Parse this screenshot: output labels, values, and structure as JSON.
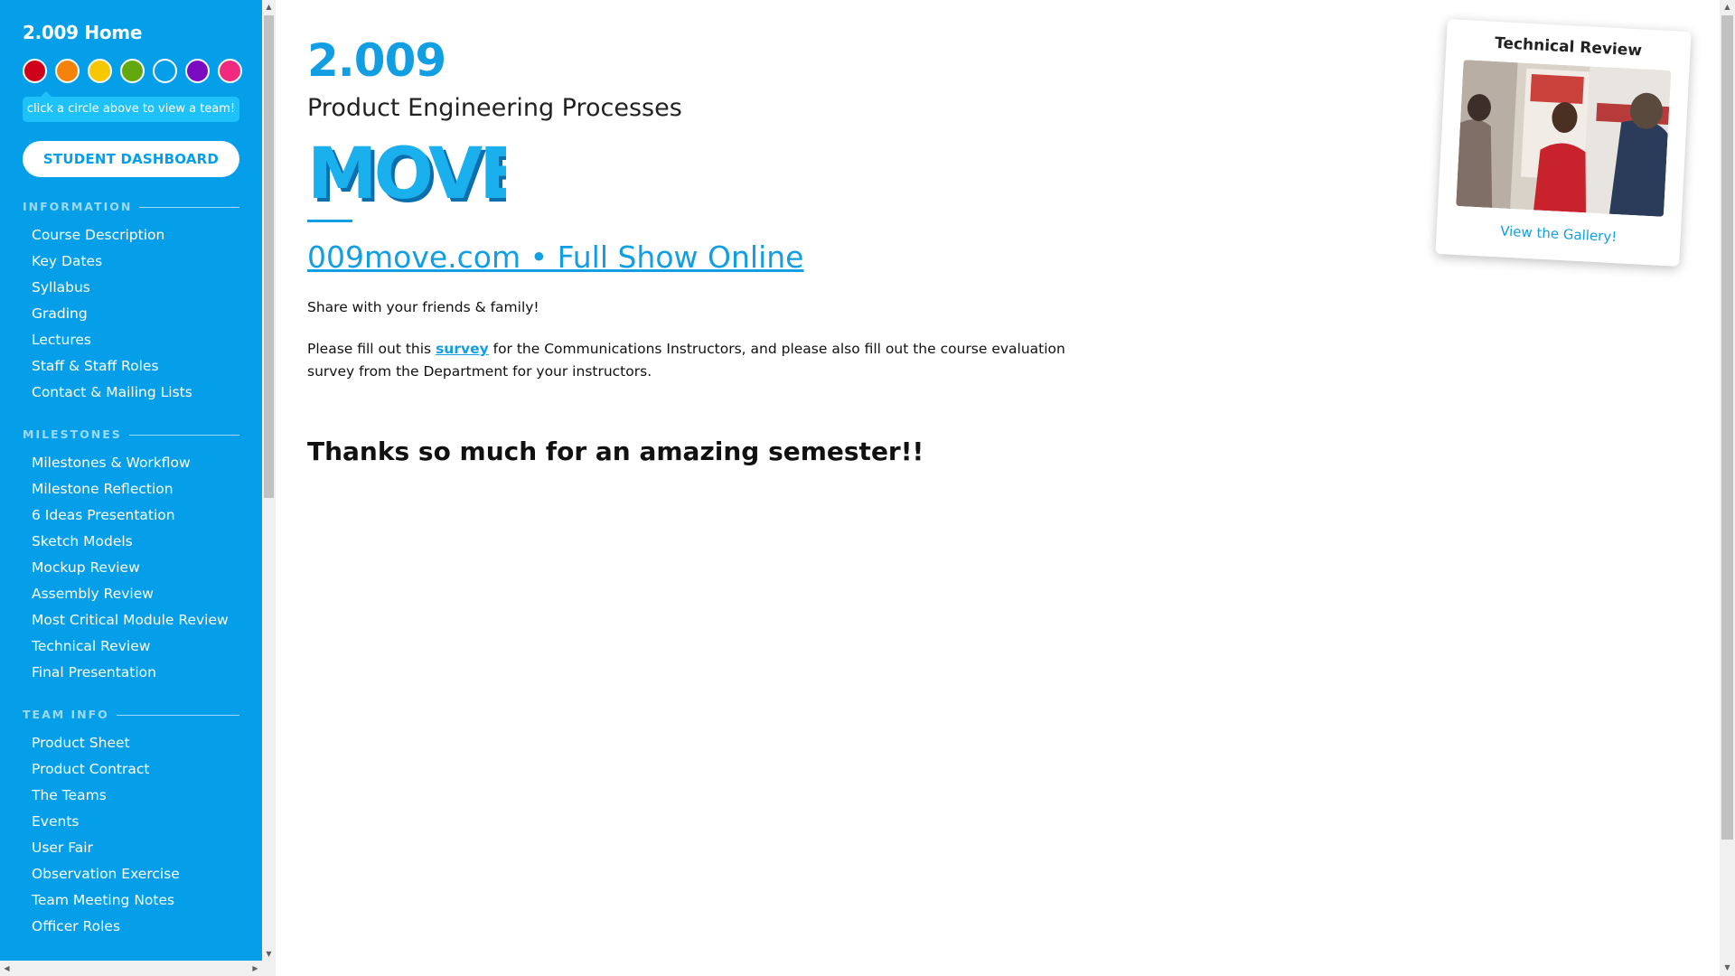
{
  "sidebar": {
    "home_title": "2.009 Home",
    "team_colors": [
      {
        "name": "red",
        "color": "#d0021b"
      },
      {
        "name": "orange",
        "color": "#f5820b"
      },
      {
        "name": "yellow",
        "color": "#f7c700"
      },
      {
        "name": "green",
        "color": "#63a80e"
      },
      {
        "name": "blue",
        "color": "#049fe8"
      },
      {
        "name": "purple",
        "color": "#7a0bc0"
      },
      {
        "name": "pink",
        "color": "#ef2a7f"
      }
    ],
    "team_hint": "click a circle above to view a team!",
    "dashboard_button": "STUDENT DASHBOARD",
    "sections": {
      "information": {
        "label": "INFORMATION",
        "items": [
          "Course Description",
          "Key Dates",
          "Syllabus",
          "Grading",
          "Lectures",
          "Staff & Staff Roles",
          "Contact & Mailing Lists"
        ]
      },
      "milestones": {
        "label": "MILESTONES",
        "items": [
          "Milestones & Workflow",
          "Milestone Reflection",
          "6 Ideas Presentation",
          "Sketch Models",
          "Mockup Review",
          "Assembly Review",
          "Most Critical Module Review",
          "Technical Review",
          "Final Presentation"
        ]
      },
      "team_info": {
        "label": "TEAM INFO",
        "items": [
          "Product Sheet",
          "Product Contract",
          "The Teams",
          "Events",
          "User Fair",
          "Observation Exercise",
          "Team Meeting Notes",
          "Officer Roles"
        ]
      }
    }
  },
  "main": {
    "course_number": "2.009",
    "course_name": "Product Engineering Processes",
    "logo_text": "MOVE",
    "show_link": "009move.com • Full Show Online",
    "share_text": "Share with your friends & family!",
    "survey_before": "Please fill out this ",
    "survey_link": "survey",
    "survey_after": " for the Communications Instructors, and please also fill out the course evaluation survey from the Department for your instructors.",
    "thanks": "Thanks so much for an amazing semester!!"
  },
  "gallery": {
    "title": "Technical Review",
    "link": "View the Gallery!"
  },
  "colors": {
    "sidebar_bg": "#049fe8",
    "accent": "#129ee3"
  }
}
